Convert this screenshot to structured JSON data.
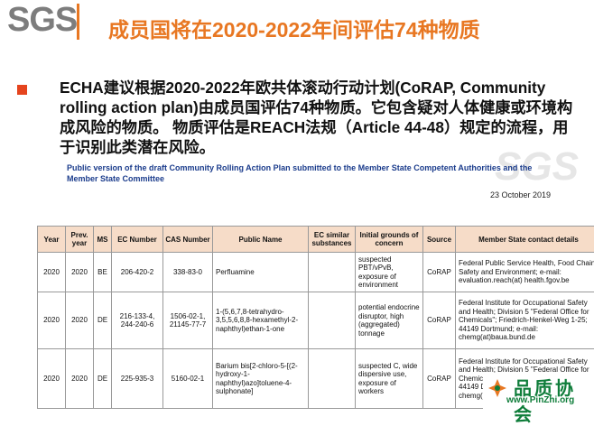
{
  "logo": {
    "text": "SGS"
  },
  "header": {
    "title": "成员国将在2020-2022年间评估74种物质"
  },
  "bullet": {
    "text": "ECHA建议根据2020-2022年欧共体滚动行动计划(CoRAP, Community rolling action plan)由成员国评估74种物质。它包含疑对人体健康或环境构成风险的物质。 物质评估是REACH法规（Article 44-48）规定的流程，用于识别此类潜在风险。"
  },
  "document": {
    "heading": "Public version of the draft Community Rolling Action Plan submitted to the Member State Competent Authorities and the Member State Committee",
    "date": "23 October 2019",
    "watermark": "SGS"
  },
  "table": {
    "headers": [
      "Year",
      "Prev. year",
      "MS",
      "EC Number",
      "CAS Number",
      "Public Name",
      "EC similar substances",
      "Initial grounds of concern",
      "Source",
      "Member State contact details"
    ],
    "rows": [
      {
        "year": "2020",
        "prev": "2020",
        "ms": "BE",
        "ec": "206-420-2",
        "cas": "338-83-0",
        "name": "Perfluamine",
        "similar": "",
        "grounds": "suspected PBT/vPvB, exposure of environment",
        "source": "CoRAP",
        "contact": "Federal Public Service Health, Food Chain Safety and Environment; e-mail: evaluation.reach(at) health.fgov.be"
      },
      {
        "year": "2020",
        "prev": "2020",
        "ms": "DE",
        "ec": "216-133-4, 244-240-6",
        "cas": "1506-02-1, 21145-77-7",
        "name": "1-(5,6,7,8-tetrahydro-3,5,5,6,8,8-hexamethyl-2-naphthyl)ethan-1-one",
        "similar": "",
        "grounds": "potential endocrine disruptor, high (aggregated) tonnage",
        "source": "CoRAP",
        "contact": "Federal Institute for Occupational Safety and Health; Division 5 \"Federal Office for Chemicals\"; Friedrich-Henkel-Weg 1-25; 44149 Dortmund; e-mail: chemg(at)baua.bund.de"
      },
      {
        "year": "2020",
        "prev": "2020",
        "ms": "DE",
        "ec": "225-935-3",
        "cas": "5160-02-1",
        "name": "Barium bis[2-chloro-5-[(2-hydroxy-1-naphthyl)azo]toluene-4-sulphonate]",
        "similar": "",
        "grounds": "suspected C, wide dispersive use, exposure of workers",
        "source": "CoRAP",
        "contact": "Federal Institute for Occupational Safety and Health; Division 5 \"Federal Office for Chemicals\"; Friedrich-Henkel-Weg 1-25; 44149 Dortmund; e-mail: chemg(at)baua.bund.de"
      }
    ]
  },
  "site_watermark": {
    "cn": "品质协会",
    "url": "www.PinZhi.org"
  },
  "colors": {
    "accent": "#e87722",
    "bullet": "#e5441e",
    "heading_blue": "#1b3c8c",
    "table_header": "#f6dcc8",
    "watermark_green": "#0f7d3a"
  }
}
